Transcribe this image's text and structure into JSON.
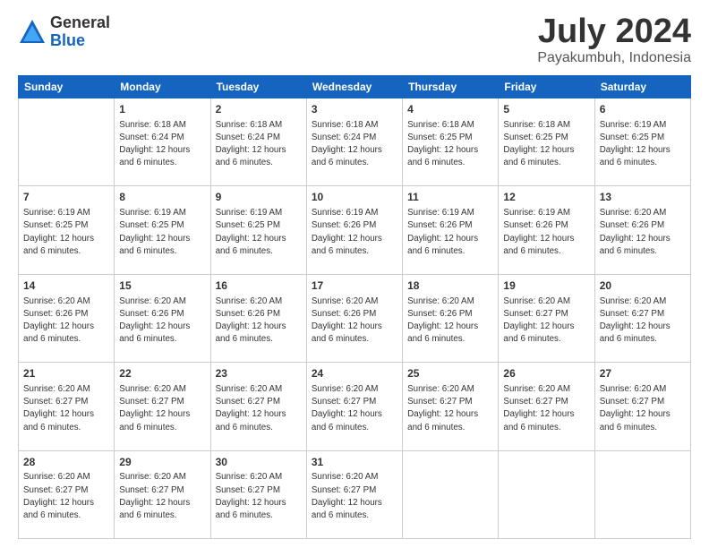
{
  "header": {
    "logo_general": "General",
    "logo_blue": "Blue",
    "month_title": "July 2024",
    "location": "Payakumbuh, Indonesia"
  },
  "days_of_week": [
    "Sunday",
    "Monday",
    "Tuesday",
    "Wednesday",
    "Thursday",
    "Friday",
    "Saturday"
  ],
  "weeks": [
    [
      {
        "day": "",
        "info": ""
      },
      {
        "day": "1",
        "info": "Sunrise: 6:18 AM\nSunset: 6:24 PM\nDaylight: 12 hours\nand 6 minutes."
      },
      {
        "day": "2",
        "info": "Sunrise: 6:18 AM\nSunset: 6:24 PM\nDaylight: 12 hours\nand 6 minutes."
      },
      {
        "day": "3",
        "info": "Sunrise: 6:18 AM\nSunset: 6:24 PM\nDaylight: 12 hours\nand 6 minutes."
      },
      {
        "day": "4",
        "info": "Sunrise: 6:18 AM\nSunset: 6:25 PM\nDaylight: 12 hours\nand 6 minutes."
      },
      {
        "day": "5",
        "info": "Sunrise: 6:18 AM\nSunset: 6:25 PM\nDaylight: 12 hours\nand 6 minutes."
      },
      {
        "day": "6",
        "info": "Sunrise: 6:19 AM\nSunset: 6:25 PM\nDaylight: 12 hours\nand 6 minutes."
      }
    ],
    [
      {
        "day": "7",
        "info": "Sunrise: 6:19 AM\nSunset: 6:25 PM\nDaylight: 12 hours\nand 6 minutes."
      },
      {
        "day": "8",
        "info": "Sunrise: 6:19 AM\nSunset: 6:25 PM\nDaylight: 12 hours\nand 6 minutes."
      },
      {
        "day": "9",
        "info": "Sunrise: 6:19 AM\nSunset: 6:25 PM\nDaylight: 12 hours\nand 6 minutes."
      },
      {
        "day": "10",
        "info": "Sunrise: 6:19 AM\nSunset: 6:26 PM\nDaylight: 12 hours\nand 6 minutes."
      },
      {
        "day": "11",
        "info": "Sunrise: 6:19 AM\nSunset: 6:26 PM\nDaylight: 12 hours\nand 6 minutes."
      },
      {
        "day": "12",
        "info": "Sunrise: 6:19 AM\nSunset: 6:26 PM\nDaylight: 12 hours\nand 6 minutes."
      },
      {
        "day": "13",
        "info": "Sunrise: 6:20 AM\nSunset: 6:26 PM\nDaylight: 12 hours\nand 6 minutes."
      }
    ],
    [
      {
        "day": "14",
        "info": "Sunrise: 6:20 AM\nSunset: 6:26 PM\nDaylight: 12 hours\nand 6 minutes."
      },
      {
        "day": "15",
        "info": "Sunrise: 6:20 AM\nSunset: 6:26 PM\nDaylight: 12 hours\nand 6 minutes."
      },
      {
        "day": "16",
        "info": "Sunrise: 6:20 AM\nSunset: 6:26 PM\nDaylight: 12 hours\nand 6 minutes."
      },
      {
        "day": "17",
        "info": "Sunrise: 6:20 AM\nSunset: 6:26 PM\nDaylight: 12 hours\nand 6 minutes."
      },
      {
        "day": "18",
        "info": "Sunrise: 6:20 AM\nSunset: 6:26 PM\nDaylight: 12 hours\nand 6 minutes."
      },
      {
        "day": "19",
        "info": "Sunrise: 6:20 AM\nSunset: 6:27 PM\nDaylight: 12 hours\nand 6 minutes."
      },
      {
        "day": "20",
        "info": "Sunrise: 6:20 AM\nSunset: 6:27 PM\nDaylight: 12 hours\nand 6 minutes."
      }
    ],
    [
      {
        "day": "21",
        "info": "Sunrise: 6:20 AM\nSunset: 6:27 PM\nDaylight: 12 hours\nand 6 minutes."
      },
      {
        "day": "22",
        "info": "Sunrise: 6:20 AM\nSunset: 6:27 PM\nDaylight: 12 hours\nand 6 minutes."
      },
      {
        "day": "23",
        "info": "Sunrise: 6:20 AM\nSunset: 6:27 PM\nDaylight: 12 hours\nand 6 minutes."
      },
      {
        "day": "24",
        "info": "Sunrise: 6:20 AM\nSunset: 6:27 PM\nDaylight: 12 hours\nand 6 minutes."
      },
      {
        "day": "25",
        "info": "Sunrise: 6:20 AM\nSunset: 6:27 PM\nDaylight: 12 hours\nand 6 minutes."
      },
      {
        "day": "26",
        "info": "Sunrise: 6:20 AM\nSunset: 6:27 PM\nDaylight: 12 hours\nand 6 minutes."
      },
      {
        "day": "27",
        "info": "Sunrise: 6:20 AM\nSunset: 6:27 PM\nDaylight: 12 hours\nand 6 minutes."
      }
    ],
    [
      {
        "day": "28",
        "info": "Sunrise: 6:20 AM\nSunset: 6:27 PM\nDaylight: 12 hours\nand 6 minutes."
      },
      {
        "day": "29",
        "info": "Sunrise: 6:20 AM\nSunset: 6:27 PM\nDaylight: 12 hours\nand 6 minutes."
      },
      {
        "day": "30",
        "info": "Sunrise: 6:20 AM\nSunset: 6:27 PM\nDaylight: 12 hours\nand 6 minutes."
      },
      {
        "day": "31",
        "info": "Sunrise: 6:20 AM\nSunset: 6:27 PM\nDaylight: 12 hours\nand 6 minutes."
      },
      {
        "day": "",
        "info": ""
      },
      {
        "day": "",
        "info": ""
      },
      {
        "day": "",
        "info": ""
      }
    ]
  ]
}
